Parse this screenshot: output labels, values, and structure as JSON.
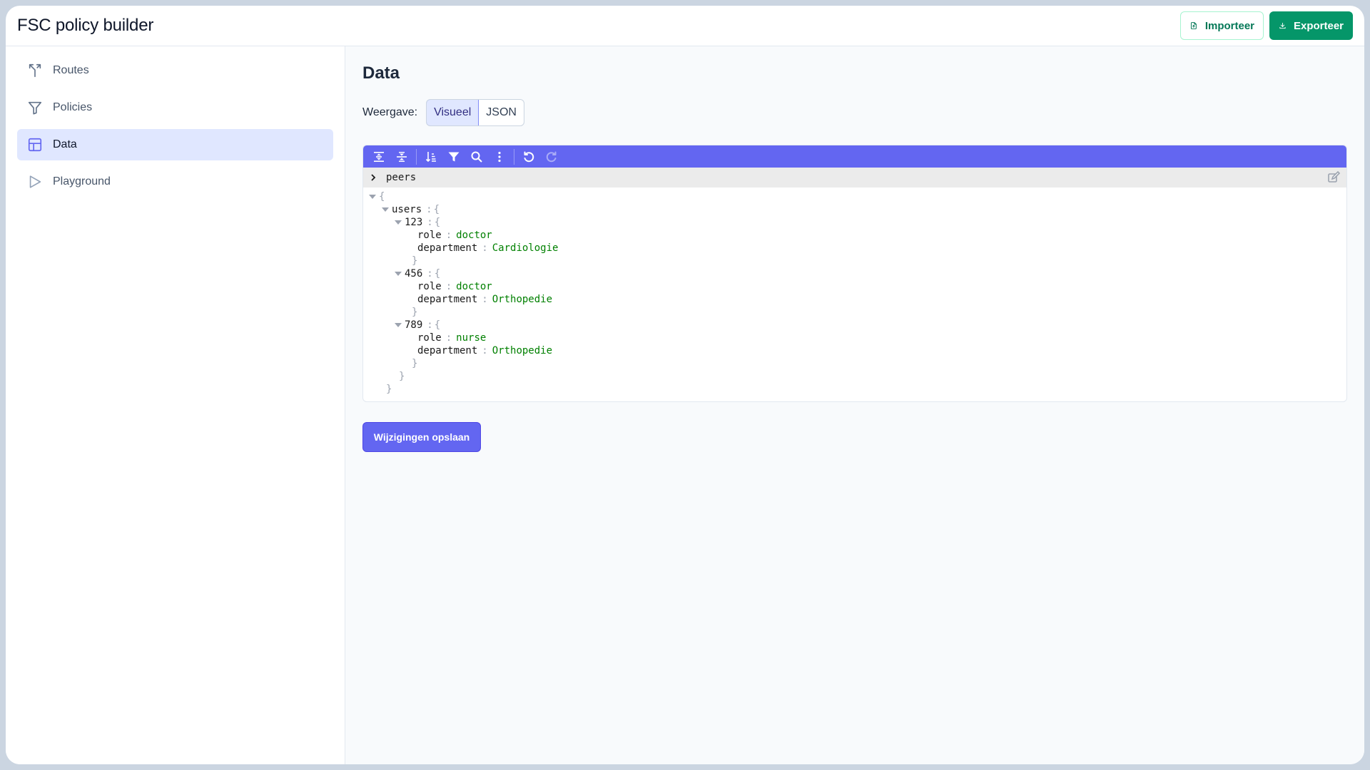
{
  "header": {
    "title": "FSC policy builder",
    "import_label": "Importeer",
    "export_label": "Exporteer"
  },
  "sidebar": {
    "items": [
      {
        "label": "Routes",
        "icon": "split-route-icon",
        "active": false
      },
      {
        "label": "Policies",
        "icon": "filter-icon",
        "active": false
      },
      {
        "label": "Data",
        "icon": "table-icon",
        "active": true
      },
      {
        "label": "Playground",
        "icon": "play-icon",
        "active": false
      }
    ]
  },
  "main": {
    "title": "Data",
    "view_label": "Weergave:",
    "view_options": [
      "Visueel",
      "JSON"
    ],
    "view_selected": "Visueel",
    "editor": {
      "toolbar": [
        "expand-all-icon",
        "collapse-all-icon",
        "sort-icon",
        "filter-icon",
        "search-icon",
        "more-icon",
        "undo-icon",
        "redo-icon"
      ],
      "breadcrumb": "peers",
      "open_brace": "{",
      "close_brace": "}",
      "separator": ":",
      "root_key": "users",
      "users": [
        {
          "id": "123",
          "fields": [
            {
              "key": "role",
              "value": "doctor"
            },
            {
              "key": "department",
              "value": "Cardiologie"
            }
          ]
        },
        {
          "id": "456",
          "fields": [
            {
              "key": "role",
              "value": "doctor"
            },
            {
              "key": "department",
              "value": "Orthopedie"
            }
          ]
        },
        {
          "id": "789",
          "fields": [
            {
              "key": "role",
              "value": "nurse"
            },
            {
              "key": "department",
              "value": "Orthopedie"
            }
          ]
        }
      ]
    },
    "save_label": "Wijzigingen opslaan"
  },
  "colors": {
    "accent": "#6366f1",
    "export": "#059669",
    "value": "#008000"
  }
}
